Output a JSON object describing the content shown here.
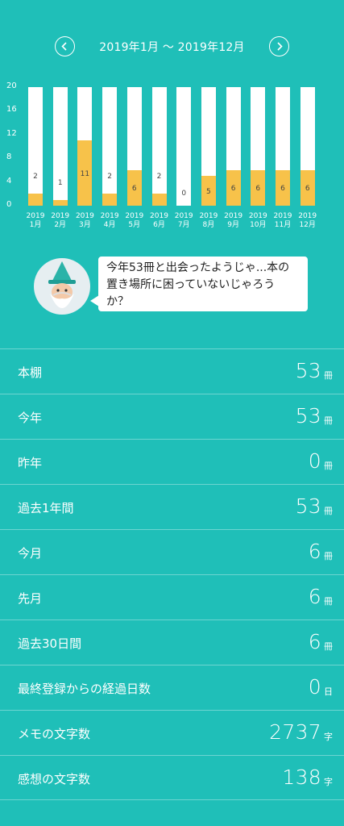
{
  "header": {
    "range": "2019年1月 〜 2019年12月"
  },
  "chart_data": {
    "type": "bar",
    "categories": [
      "2019\n1月",
      "2019\n2月",
      "2019\n3月",
      "2019\n4月",
      "2019\n5月",
      "2019\n6月",
      "2019\n7月",
      "2019\n8月",
      "2019\n9月",
      "2019\n10月",
      "2019\n11月",
      "2019\n12月"
    ],
    "values": [
      2,
      1,
      11,
      2,
      6,
      2,
      0,
      5,
      6,
      6,
      6,
      6
    ],
    "yticks": [
      "20",
      "16",
      "12",
      "8",
      "4",
      "0"
    ],
    "ylim": [
      0,
      20
    ],
    "bar_color": "#f7c24a",
    "track_color": "#ffffff"
  },
  "bubble": {
    "line1": "今年53冊と出会ったようじゃ...本の",
    "line2": "置き場所に困っていないじゃろう",
    "line3": "か？"
  },
  "stats": [
    {
      "label": "本棚",
      "value": "53",
      "unit": "冊"
    },
    {
      "label": "今年",
      "value": "53",
      "unit": "冊"
    },
    {
      "label": "昨年",
      "value": "0",
      "unit": "冊"
    },
    {
      "label": "過去1年間",
      "value": "53",
      "unit": "冊"
    },
    {
      "label": "今月",
      "value": "6",
      "unit": "冊"
    },
    {
      "label": "先月",
      "value": "6",
      "unit": "冊"
    },
    {
      "label": "過去30日間",
      "value": "6",
      "unit": "冊"
    },
    {
      "label": "最終登録からの経過日数",
      "value": "0",
      "unit": "日"
    },
    {
      "label": "メモの文字数",
      "value": "2737",
      "unit": "字"
    },
    {
      "label": "感想の文字数",
      "value": "138",
      "unit": "字"
    }
  ],
  "colors": {
    "background": "#1fbfb8",
    "accent": "#f7c24a"
  }
}
